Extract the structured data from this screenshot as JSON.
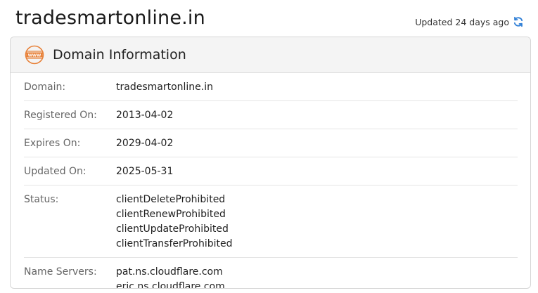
{
  "header": {
    "site_title": "tradesmartonline.in",
    "updated_text": "Updated 24 days ago"
  },
  "card": {
    "title": "Domain Information",
    "rows": [
      {
        "label": "Domain:",
        "values": [
          "tradesmartonline.in"
        ]
      },
      {
        "label": "Registered On:",
        "values": [
          "2013-04-02"
        ]
      },
      {
        "label": "Expires On:",
        "values": [
          "2029-04-02"
        ]
      },
      {
        "label": "Updated On:",
        "values": [
          "2025-05-31"
        ]
      },
      {
        "label": "Status:",
        "values": [
          "clientDeleteProhibited",
          "clientRenewProhibited",
          "clientUpdateProhibited",
          "clientTransferProhibited"
        ]
      },
      {
        "label": "Name Servers:",
        "values": [
          "pat.ns.cloudflare.com",
          "eric.ns.cloudflare.com"
        ]
      }
    ]
  },
  "icons": {
    "header_icon": "www-globe-icon",
    "refresh": "refresh-icon"
  },
  "colors": {
    "www_icon": "#e8823a",
    "refresh_icon": "#2f7fd6"
  }
}
